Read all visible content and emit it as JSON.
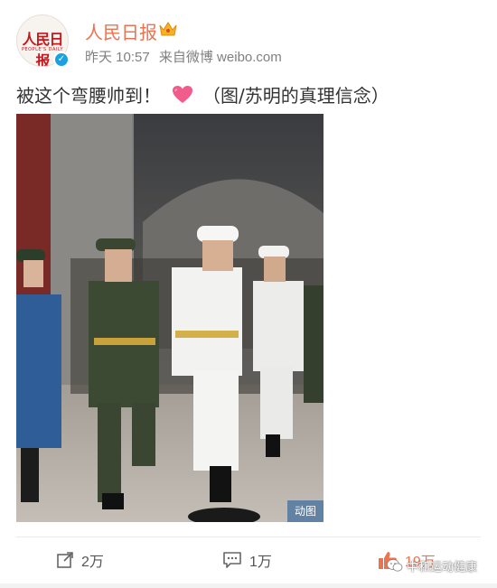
{
  "user": {
    "name": "人民日报",
    "avatar_text": "人民日报",
    "avatar_sub": "PEOPLE'S DAILY",
    "verified": "✓"
  },
  "meta": {
    "time": "昨天 10:57",
    "source": "来自微博 weibo.com"
  },
  "post": {
    "text": "被这个弯腰帅到！",
    "caption": "（图/苏明的真理信念）",
    "media_badge": "动图"
  },
  "actions": {
    "repost": "2万",
    "comment": "1万",
    "like": "19万"
  },
  "watermark": "中和运动健康",
  "colors": {
    "username": "#eb7350",
    "like": "#eb7350",
    "verified": "#1ba1e2"
  }
}
